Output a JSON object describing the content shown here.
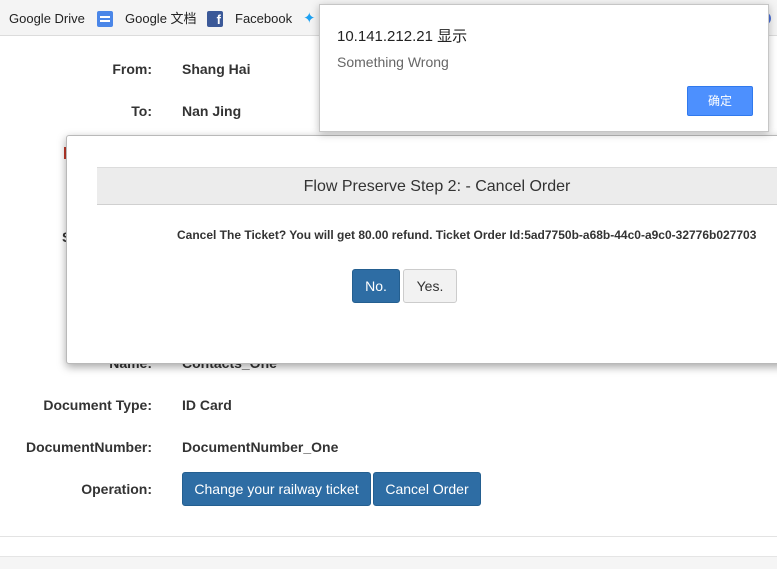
{
  "bookmarks": [
    {
      "label": "Google Drive",
      "icon": "google-drive-icon"
    },
    {
      "label": "Google 文档",
      "icon": "google-docs-icon"
    },
    {
      "label": "Facebook",
      "icon": "facebook-icon"
    },
    {
      "label": "",
      "icon": "twitter-icon"
    }
  ],
  "order": {
    "from_label": "From:",
    "from_value": "Shang Hai",
    "to_label": "To:",
    "to_value": "Nan Jing",
    "name_label": "Name:",
    "name_value": "Contacts_One",
    "document_type_label": "Document Type:",
    "document_type_value": "ID Card",
    "document_number_label": "DocumentNumber:",
    "document_number_value": "DocumentNumber_One",
    "operation_label": "Operation:",
    "change_ticket_label": "Change your railway ticket",
    "cancel_order_label": "Cancel Order",
    "partial_s": "S"
  },
  "modal": {
    "title": "Flow Preserve Step 2: - Cancel Order",
    "message": "Cancel The Ticket? You will get 80.00 refund. Ticket Order Id:5ad7750b-a68b-44c0-a9c0-32776b027703",
    "no_label": "No.",
    "yes_label": "Yes."
  },
  "alert": {
    "origin": "10.141.212.21 显示",
    "message": "Something Wrong",
    "ok_label": "确定"
  },
  "colors": {
    "primary_button": "#2e6da4",
    "alert_button": "#4d90fe",
    "twitter": "#1da1f2",
    "facebook": "#3b5998"
  }
}
